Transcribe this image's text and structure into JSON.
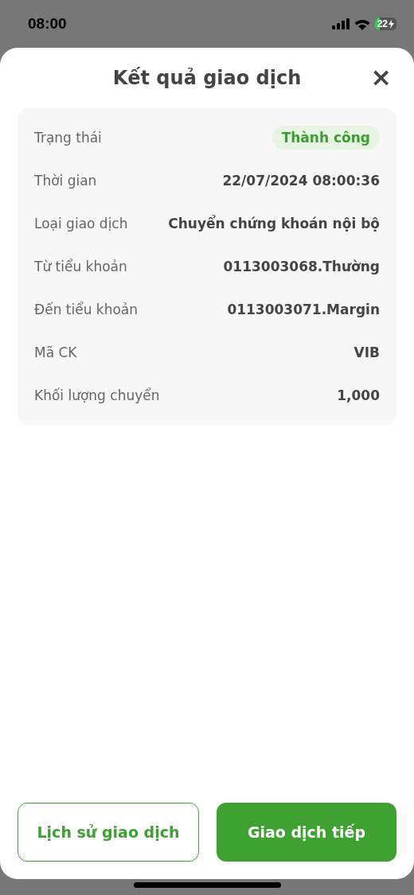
{
  "status_bar": {
    "time": "08:00",
    "battery": "22"
  },
  "sheet": {
    "title": "Kết quả giao dịch",
    "close": "×"
  },
  "details": [
    {
      "label": "Trạng thái",
      "value": "Thành công",
      "kind": "badge"
    },
    {
      "label": "Thời gian",
      "value": "22/07/2024 08:00:36",
      "kind": "text"
    },
    {
      "label": "Loại giao dịch",
      "value": "Chuyển chứng khoán nội bộ",
      "kind": "text"
    },
    {
      "label": "Từ tiểu khoản",
      "value": "0113003068.Thường",
      "kind": "text"
    },
    {
      "label": "Đến tiểu khoản",
      "value": "0113003071.Margin",
      "kind": "text"
    },
    {
      "label": "Mã CK",
      "value": "VIB",
      "kind": "text"
    },
    {
      "label": "Khối lượng chuyển",
      "value": "1,000",
      "kind": "text"
    }
  ],
  "buttons": [
    {
      "label": "Lịch sử giao dịch",
      "kind": "outline"
    },
    {
      "label": "Giao dịch tiếp",
      "kind": "filled"
    }
  ]
}
